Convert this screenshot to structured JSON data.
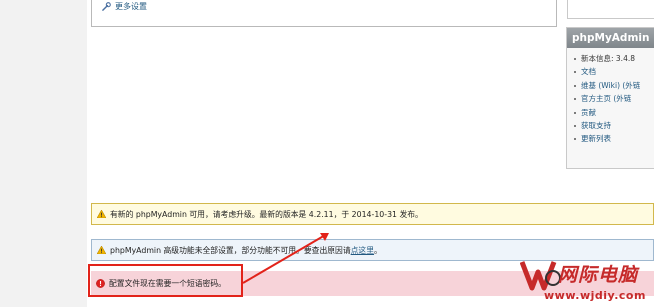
{
  "settings": {
    "more_settings": "更多设置"
  },
  "pma_box": {
    "title": "phpMyAdmin",
    "items": [
      {
        "label": "新本信息: 3.4.8",
        "link": false
      },
      {
        "label": "文档",
        "link": true
      },
      {
        "label": "维基 (Wiki) (外链",
        "link": true
      },
      {
        "label": "官方主页 (外链",
        "link": true
      },
      {
        "label": "贡献",
        "link": true
      },
      {
        "label": "获取支持",
        "link": true
      },
      {
        "label": "更新列表",
        "link": true
      }
    ]
  },
  "messages": {
    "update": "有新的 phpMyAdmin 可用，请考虑升级。最新的版本是 4.2.11，于 2014-10-31 发布。",
    "advanced_prefix": "phpMyAdmin 高级功能未全部设置，部分功能不可用。要查出原因请",
    "advanced_link": "点这里",
    "advanced_suffix": "。",
    "error": "配置文件现在需要一个短语密码。"
  },
  "watermark": {
    "name": "网际电脑",
    "url": "www.wjdiy.com"
  },
  "colors": {
    "accent": "#e2231a",
    "link": "#235a81",
    "error_bg": "#f7d3d9",
    "warning_bg": "#fffbe0"
  }
}
